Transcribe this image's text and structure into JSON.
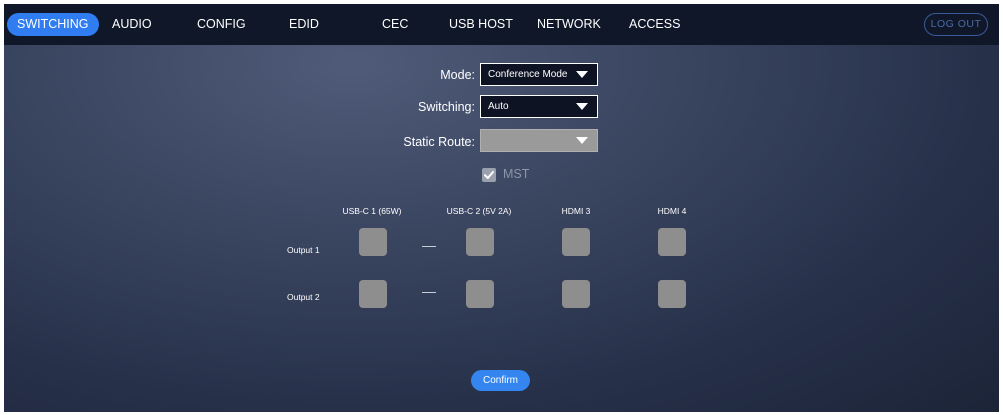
{
  "nav": {
    "tabs": [
      {
        "label": "SWITCHING",
        "active": true
      },
      {
        "label": "AUDIO",
        "active": false
      },
      {
        "label": "CONFIG",
        "active": false
      },
      {
        "label": "EDID",
        "active": false
      },
      {
        "label": "CEC",
        "active": false
      },
      {
        "label": "USB HOST",
        "active": false
      },
      {
        "label": "NETWORK",
        "active": false
      },
      {
        "label": "ACCESS",
        "active": false
      }
    ],
    "logout_label": "LOG OUT"
  },
  "form": {
    "mode_label": "Mode:",
    "mode_value": "Conference Mode",
    "switching_label": "Switching:",
    "switching_value": "Auto",
    "static_route_label": "Static Route:",
    "static_route_value": "",
    "mst_label": "MST",
    "mst_checked": true
  },
  "matrix": {
    "columns": [
      "USB-C 1 (65W)",
      "USB-C 2 (5V 2A)",
      "HDMI 3",
      "HDMI 4"
    ],
    "rows": [
      "Output 1",
      "Output 2"
    ]
  },
  "confirm_label": "Confirm",
  "colors": {
    "accent": "#2f7df0",
    "nav_bg": "#0f1729",
    "cell": "#8e8e8e"
  }
}
